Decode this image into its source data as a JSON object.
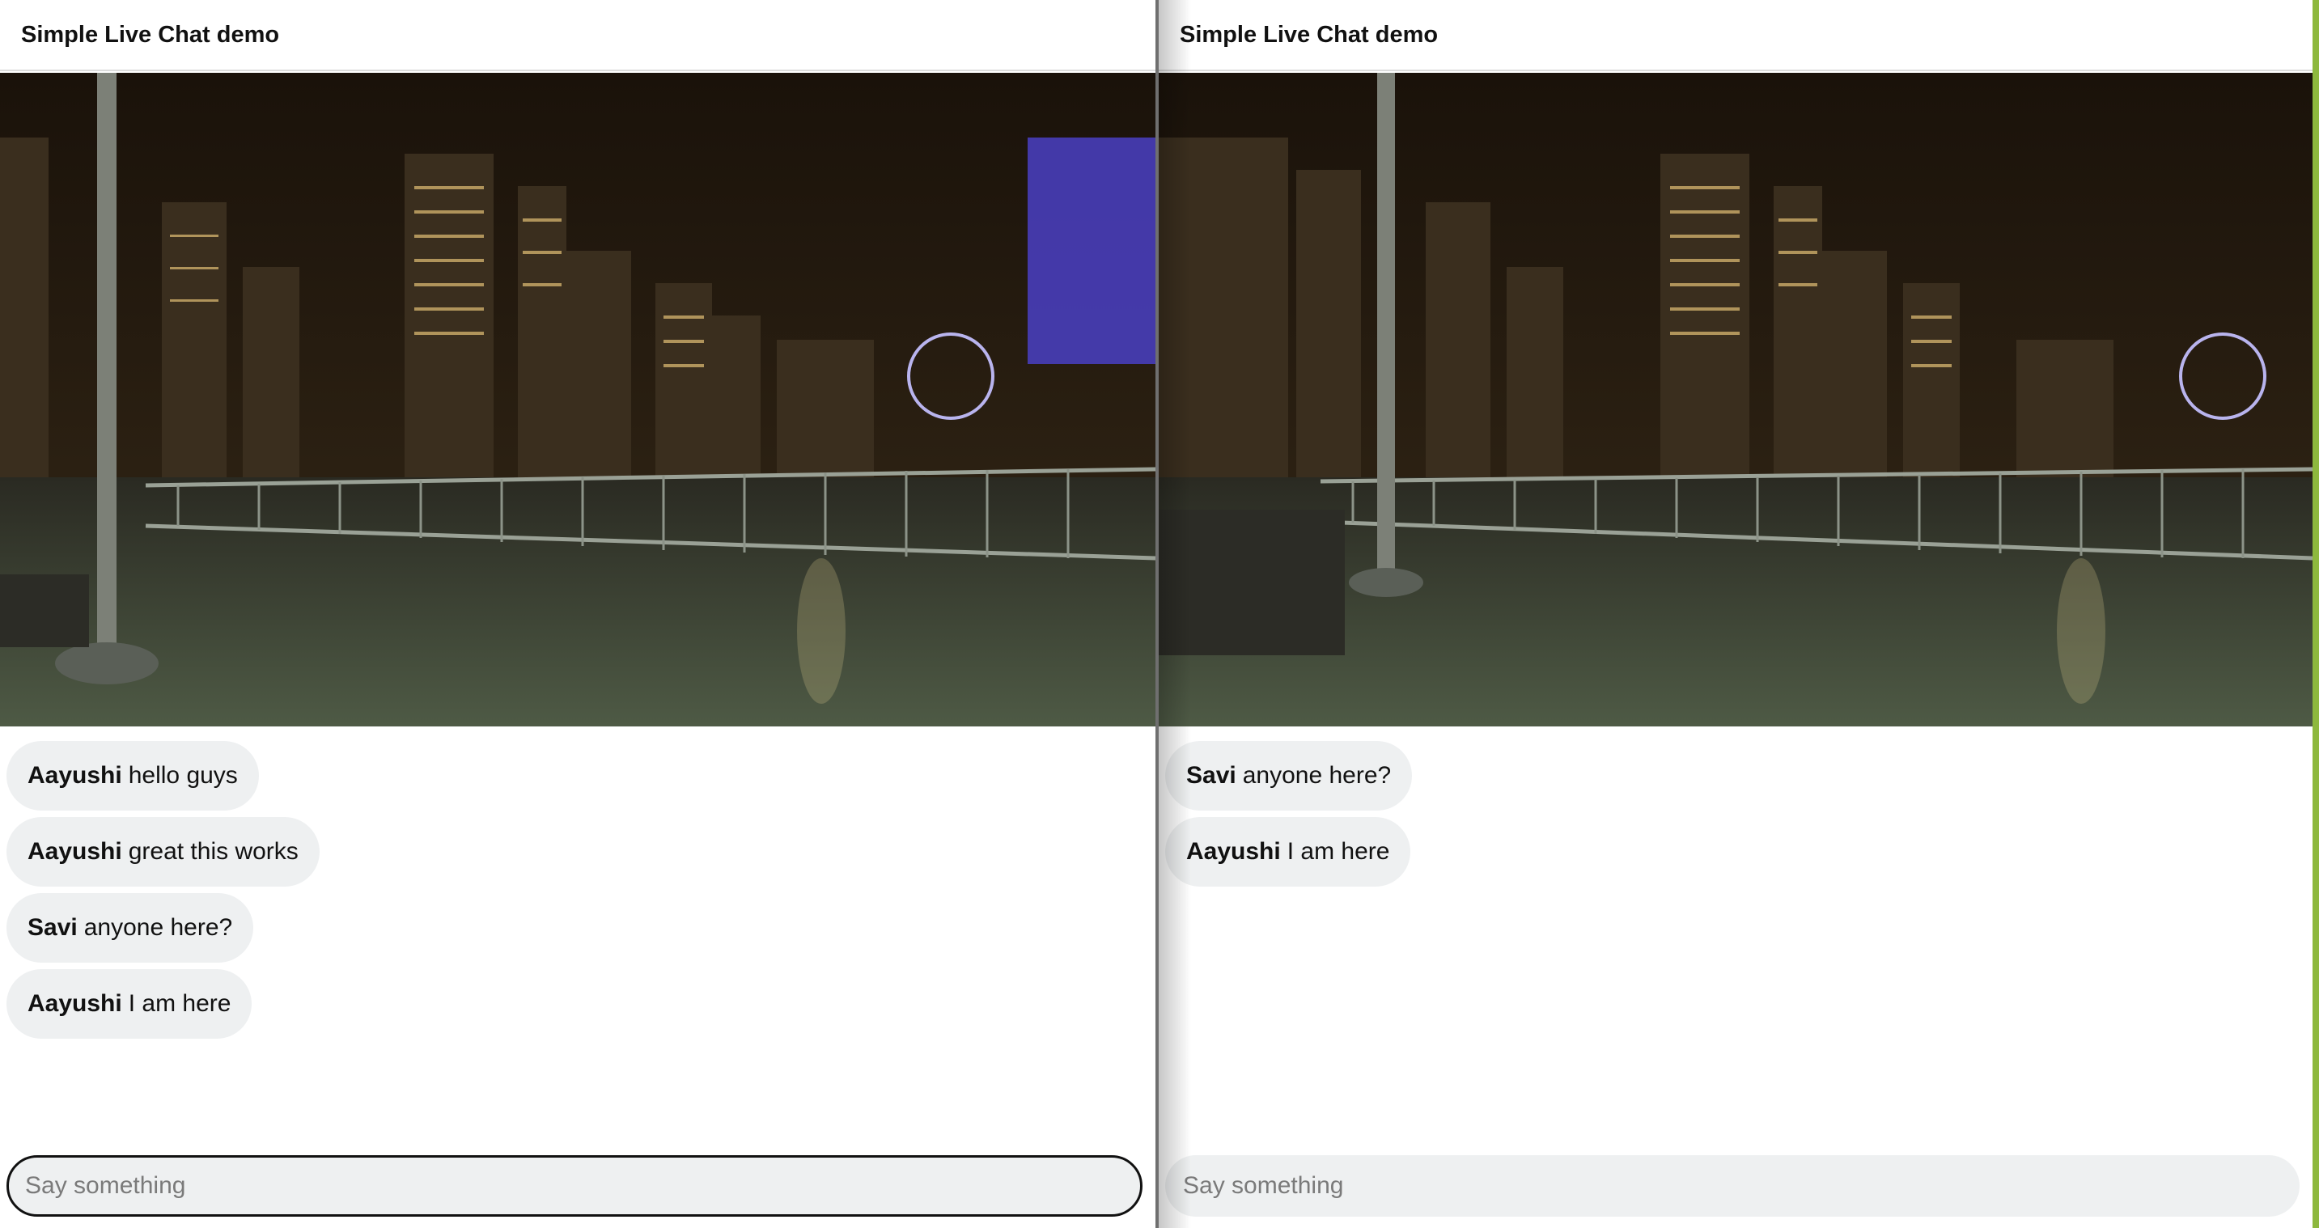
{
  "left": {
    "title": "Simple Live Chat demo",
    "messages": [
      {
        "author": "Aayushi",
        "text": "hello guys"
      },
      {
        "author": "Aayushi",
        "text": "great this works"
      },
      {
        "author": "Savi",
        "text": "anyone here?"
      },
      {
        "author": "Aayushi",
        "text": "I am here"
      }
    ],
    "input_placeholder": "Say something"
  },
  "right": {
    "title": "Simple Live Chat demo",
    "messages": [
      {
        "author": "Savi",
        "text": "anyone here?"
      },
      {
        "author": "Aayushi",
        "text": "I am here"
      }
    ],
    "input_placeholder": "Say something"
  },
  "colors": {
    "accent_edge": "#8db83e",
    "bubble": "#eef0f1"
  }
}
